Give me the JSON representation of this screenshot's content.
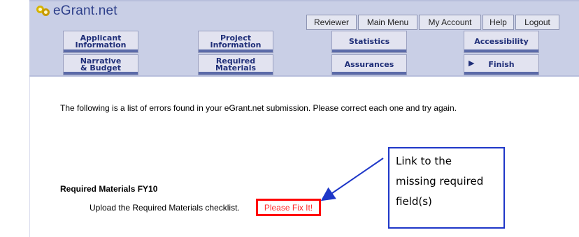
{
  "app": {
    "logo_text": "eGrant.net"
  },
  "top_nav": [
    "Reviewer",
    "Main Menu",
    "My Account",
    "Help",
    "Logout"
  ],
  "tabs": {
    "applicant_information": [
      "Applicant",
      "Information"
    ],
    "project_information": [
      "Project",
      "Information"
    ],
    "statistics": "Statistics",
    "accessibility": "Accessibility",
    "narrative_budget": [
      "Narrative",
      "& Budget"
    ],
    "required_materials": [
      "Required",
      "Materials"
    ],
    "assurances": "Assurances",
    "finish": "Finish"
  },
  "main": {
    "error_message": "The following is a list of errors found in your eGrant.net submission. Please correct each one and try again.",
    "section_title": "Required Materials FY10",
    "upload_text": "Upload the Required Materials checklist.",
    "fix_link": "Please Fix It!"
  },
  "callout": {
    "lines": [
      "Link to the",
      "missing required",
      "field(s)"
    ]
  },
  "colors": {
    "header_bg": "#c9cfe6",
    "tab_text": "#1f2e78",
    "fix_red": "#ff0000",
    "callout_blue": "#1e37c8"
  }
}
